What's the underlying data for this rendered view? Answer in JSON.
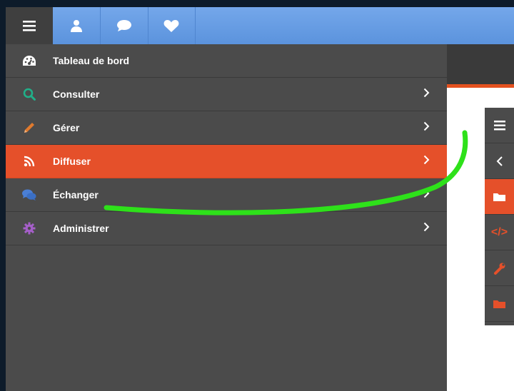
{
  "menu": {
    "items": [
      {
        "label": "Tableau de bord",
        "icon": "dashboard-icon",
        "icon_color": "#ffffff",
        "has_submenu": false
      },
      {
        "label": "Consulter",
        "icon": "search-icon",
        "icon_color": "#20b089",
        "has_submenu": true
      },
      {
        "label": "Gérer",
        "icon": "pencil-icon",
        "icon_color": "#e07a2e",
        "has_submenu": true
      },
      {
        "label": "Diffuser",
        "icon": "rss-icon",
        "icon_color": "#ffffff",
        "has_submenu": true,
        "active": true
      },
      {
        "label": "Échanger",
        "icon": "chat-bubbles-icon",
        "icon_color": "#4a7fd6",
        "has_submenu": true
      },
      {
        "label": "Administrer",
        "icon": "cog-icon",
        "icon_color": "#a55fc9",
        "has_submenu": true
      }
    ]
  },
  "topbar": {
    "buttons": [
      "menu-icon",
      "user-icon",
      "chat-icon",
      "heart-icon"
    ]
  },
  "colors": {
    "accent": "#e5502a",
    "topbar": "#6aa0e6",
    "menu_bg": "#4b4b4b",
    "annotation_stroke": "#2ee11a"
  }
}
